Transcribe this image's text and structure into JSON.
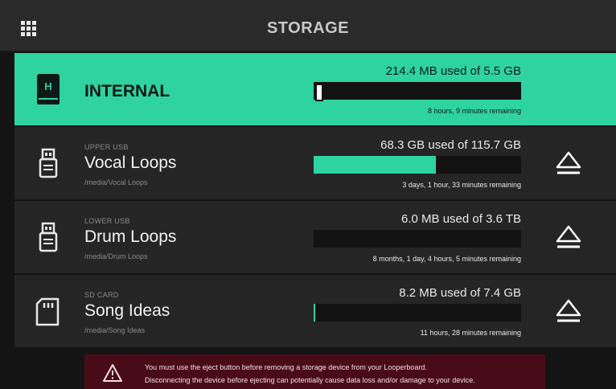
{
  "header": {
    "title": "STORAGE",
    "menu_icon": "apps-grid-icon"
  },
  "devices": [
    {
      "label": "",
      "name": "INTERNAL",
      "path": "",
      "usage": "214.4 MB used of 5.5 GB",
      "remaining": "8 hours, 9 minutes remaining",
      "fill": 0.04,
      "selected": true,
      "icon": "internal-drive-icon"
    },
    {
      "label": "UPPER USB",
      "name": "Vocal Loops",
      "path": "/media/Vocal Loops",
      "usage": "68.3 GB used of 115.7 GB",
      "remaining": "3 days, 1 hour, 33 minutes remaining",
      "fill": 0.59,
      "selected": false,
      "icon": "usb-drive-icon"
    },
    {
      "label": "LOWER USB",
      "name": "Drum Loops",
      "path": "/media/Drum Loops",
      "usage": "6.0 MB used of 3.6 TB",
      "remaining": "8 months, 1 day, 4 hours, 5 minutes remaining",
      "fill": 0.0,
      "selected": false,
      "icon": "usb-drive-icon"
    },
    {
      "label": "SD CARD",
      "name": "Song Ideas",
      "path": "/media/Song Ideas",
      "usage": "8.2 MB used of 7.4 GB",
      "remaining": "11 hours, 28 minutes remaining",
      "fill": 0.001,
      "selected": false,
      "icon": "sd-card-icon"
    }
  ],
  "warning": {
    "line1": "You must use the eject button before removing a storage device from your Looperboard.",
    "line2": "Disconnecting the device before ejecting can potentially cause data loss and/or damage to your device.",
    "icon": "warning-triangle-icon"
  },
  "colors": {
    "accent": "#2ed3a0",
    "row_bg": "#252525",
    "bar_bg": "#121212",
    "warning_bg": "#4a0b18"
  }
}
